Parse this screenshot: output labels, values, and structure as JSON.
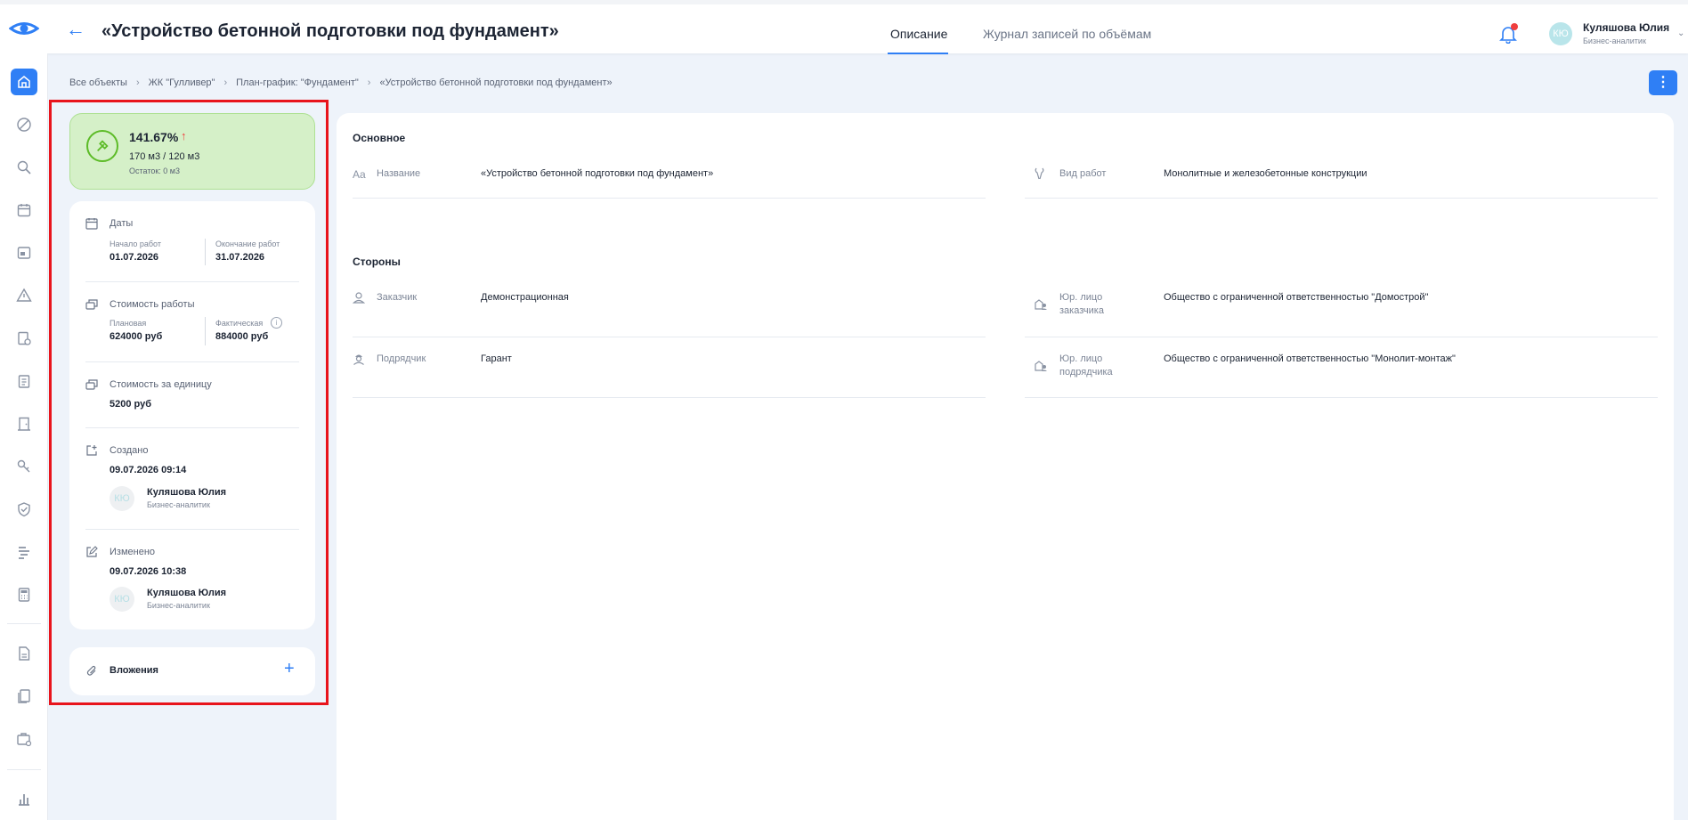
{
  "header": {
    "title": "«Устройство бетонной подготовки под фундамент»",
    "tabs": [
      {
        "label": "Описание",
        "active": true
      },
      {
        "label": "Журнал записей по объёмам",
        "active": false
      }
    ],
    "user": {
      "initials": "КЮ",
      "name": "Куляшова Юлия",
      "role": "Бизнес-аналитик"
    }
  },
  "breadcrumb": [
    "Все объекты",
    "ЖК \"Гулливер\"",
    "План-график: \"Фундамент\"",
    "«Устройство бетонной подготовки под фундамент»"
  ],
  "sidebar": {
    "items": [
      {
        "icon": "home-icon",
        "active": true
      },
      {
        "icon": "cancel-circle-icon"
      },
      {
        "icon": "search-icon"
      },
      {
        "icon": "calendar-icon"
      },
      {
        "icon": "window-icon"
      },
      {
        "icon": "warning-icon"
      },
      {
        "icon": "schedule-icon"
      },
      {
        "icon": "clipboard-icon"
      },
      {
        "icon": "door-icon"
      },
      {
        "icon": "key-icon"
      },
      {
        "icon": "shield-icon"
      },
      {
        "icon": "gantt-icon"
      },
      {
        "icon": "calculator-icon"
      },
      {
        "icon": "document-icon"
      },
      {
        "icon": "documents-icon"
      },
      {
        "icon": "briefcase-icon"
      },
      {
        "icon": "bar-chart-icon"
      }
    ]
  },
  "progress": {
    "percent": "141.67%",
    "volume": "170 м3 / 120 м3",
    "rest": "Остаток: 0 м3",
    "accent": "#5cbb27"
  },
  "dates": {
    "title": "Даты",
    "start_label": "Начало работ",
    "start_value": "01.07.2026",
    "end_label": "Окончание работ",
    "end_value": "31.07.2026"
  },
  "cost": {
    "title": "Стоимость работы",
    "planned_label": "Плановая",
    "planned_value": "624000 руб",
    "actual_label": "Фактическая",
    "actual_value": "884000 руб"
  },
  "unit_cost": {
    "title": "Стоимость за единицу",
    "value": "5200 руб"
  },
  "created": {
    "title": "Создано",
    "datetime": "09.07.2026 09:14",
    "initials": "КЮ",
    "name": "Куляшова Юлия",
    "role": "Бизнес-аналитик"
  },
  "modified": {
    "title": "Изменено",
    "datetime": "09.07.2026 10:38",
    "initials": "КЮ",
    "name": "Куляшова Юлия",
    "role": "Бизнес-аналитик"
  },
  "attachments": {
    "label": "Вложения"
  },
  "main": {
    "basic": {
      "title": "Основное",
      "name_icon": "Aa",
      "name_label": "Название",
      "name_value": "«Устройство бетонной подготовки под фундамент»",
      "work_type_label": "Вид работ",
      "work_type_value": "Монолитные и железобетонные конструкции"
    },
    "parties": {
      "title": "Стороны",
      "customer_label": "Заказчик",
      "customer_value": "Демонстрационная",
      "customer_entity_label_1": "Юр. лицо",
      "customer_entity_label_2": "заказчика",
      "customer_entity_value": "Общество с ограниченной ответственностью \"Домострой\"",
      "contractor_label": "Подрядчик",
      "contractor_value": "Гарант",
      "contractor_entity_label_1": "Юр. лицо",
      "contractor_entity_label_2": "подрядчика",
      "contractor_entity_value": "Общество с ограниченной ответственностью \"Монолит-монтаж\""
    }
  }
}
